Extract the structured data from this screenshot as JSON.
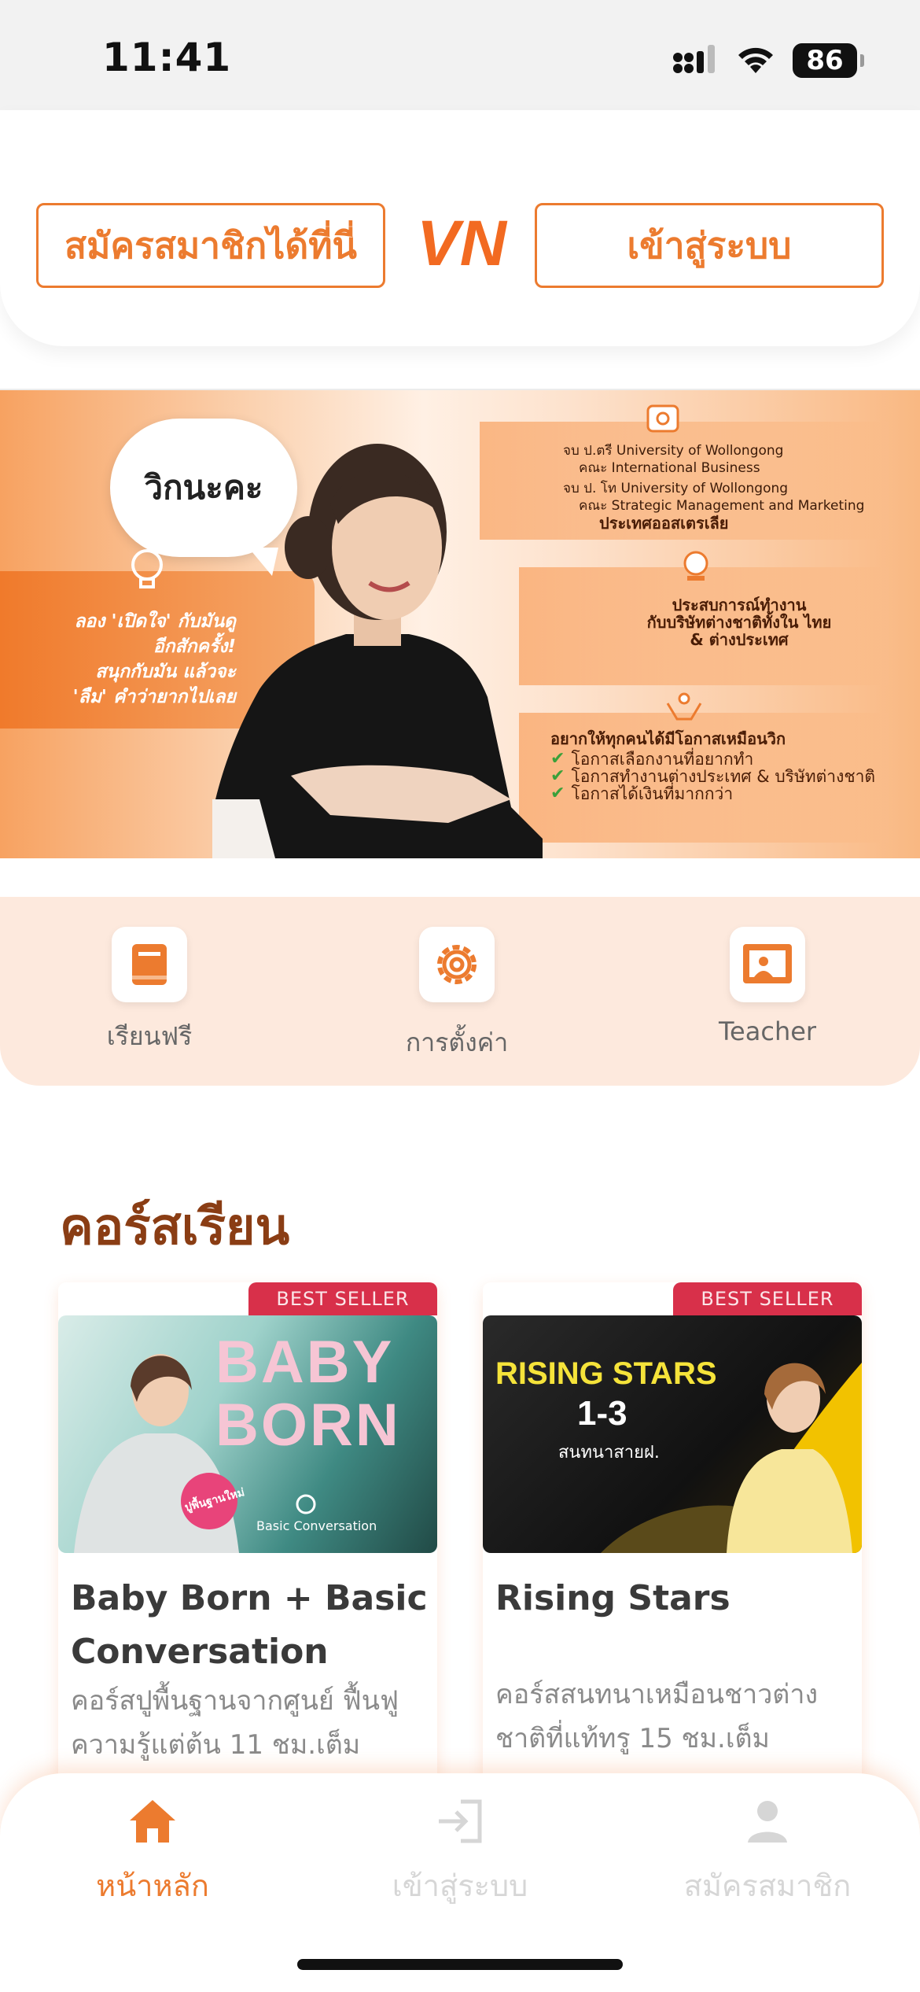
{
  "status_bar": {
    "time": "11:41",
    "battery": "86"
  },
  "header": {
    "register_label": "สมัครสมาชิกได้ที่นี่",
    "logo_text": "VN",
    "login_label": "เข้าสู่ระบบ"
  },
  "banner": {
    "bubble_text": "วิกนะคะ",
    "left_text": [
      "ลอง 'เปิดใจ' กับมันดู",
      "อีกสักครั้ง!",
      "สนุกกับมัน แล้วจะ",
      "'ลืม' คำว่ายากไปเลย"
    ],
    "edu": [
      "จบ ป.ตรี University of Wollongong",
      "คณะ International Business",
      "จบ ป. โท University of Wollongong",
      "คณะ Strategic Management and Marketing",
      "ประเทศออสเตรเลีย"
    ],
    "experience": [
      "ประสบการณ์ทำงาน",
      "กับบริษัทต่างชาติทั้งใน ไทย",
      "& ต่างประเทศ"
    ],
    "wish_title": "อยากให้ทุกคนได้มีโอกาสเหมือนวิก",
    "wishes": [
      "โอกาสเลือกงานที่อยากทำ",
      "โอกาสทำงานต่างประเทศ & บริษัทต่างชาติ",
      "โอกาสได้เงินที่มากกว่า"
    ]
  },
  "quick_menu": [
    {
      "label": "เรียนฟรี",
      "icon": "book-icon"
    },
    {
      "label": "การตั้งค่า",
      "icon": "gear-icon"
    },
    {
      "label": "Teacher",
      "icon": "teacher-board-icon"
    }
  ],
  "courses": {
    "section_title": "คอร์สเรียน",
    "items": [
      {
        "badge": "BEST SELLER",
        "image_title_1": "BABY",
        "image_title_2": "BORN",
        "image_sticker": "ปูพื้นฐานใหม่",
        "image_sub": "Basic Conversation",
        "title": "Baby Born + Basic Conversation",
        "desc": "คอร์สปูพื้นฐานจากศูนย์ ฟื้นฟูความรู้แต่ต้น 11 ชม.เต็ม"
      },
      {
        "badge": "BEST SELLER",
        "image_title_1": "RISING STARS",
        "image_title_2": "1-3",
        "image_sub": "สนทนาสายฝ.",
        "title": "Rising Stars",
        "desc": "คอร์สสนทนาเหมือนชาวต่างชาติที่แท้ทรู 15 ชม.เต็ม"
      }
    ]
  },
  "bottom_nav": [
    {
      "label": "หน้าหลัก",
      "icon": "home-icon",
      "active": true
    },
    {
      "label": "เข้าสู่ระบบ",
      "icon": "login-icon",
      "active": false
    },
    {
      "label": "สมัครสมาชิก",
      "icon": "user-icon",
      "active": false
    }
  ],
  "colors": {
    "accent": "#ec7b2f",
    "brand_dark": "#8a3d14",
    "badge": "#d8304a",
    "quick_bg": "#fde9dd"
  }
}
